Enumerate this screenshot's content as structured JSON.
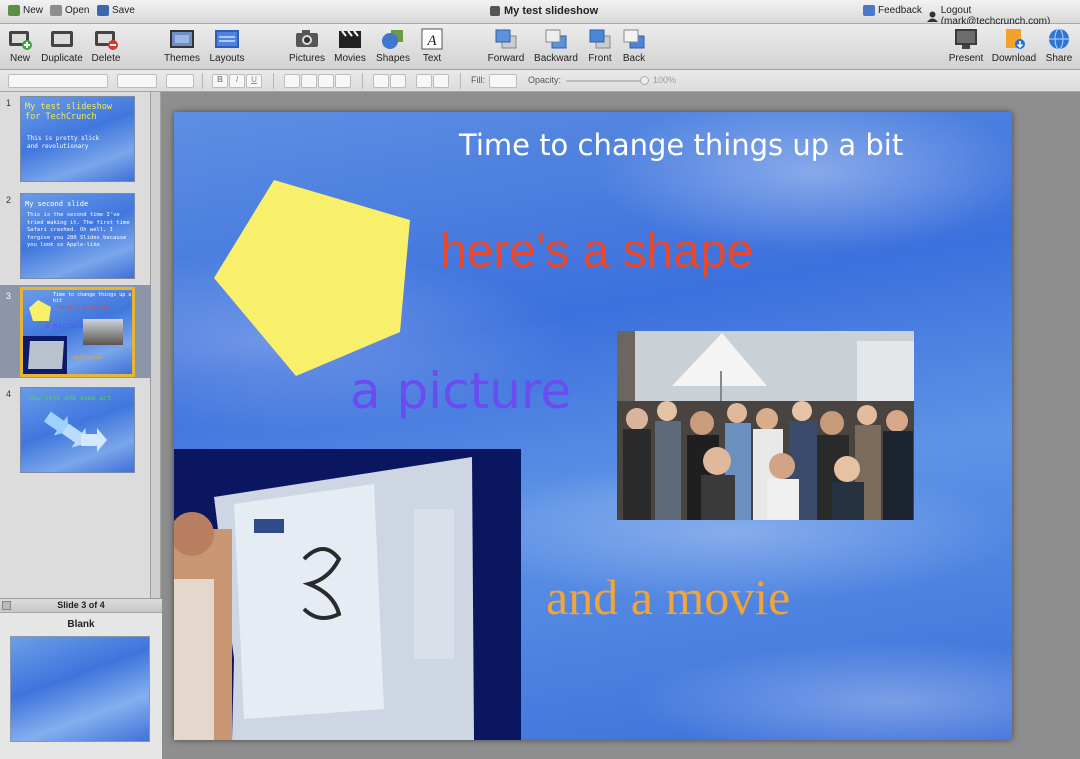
{
  "menubar": {
    "new_label": "New",
    "open_label": "Open",
    "save_label": "Save",
    "document_title": "My test slideshow",
    "feedback_label": "Feedback",
    "logout_label": "Logout (mark@techcrunch.com)"
  },
  "toolbar": {
    "new": "New",
    "duplicate": "Duplicate",
    "delete": "Delete",
    "themes": "Themes",
    "layouts": "Layouts",
    "pictures": "Pictures",
    "movies": "Movies",
    "shapes": "Shapes",
    "text": "Text",
    "forward": "Forward",
    "backward": "Backward",
    "front": "Front",
    "back": "Back",
    "present": "Present",
    "download": "Download",
    "share": "Share"
  },
  "formatbar": {
    "bold": "B",
    "italic": "I",
    "underline": "U",
    "fill_label": "Fill:",
    "opacity_label": "Opacity:",
    "opacity_value": "100%"
  },
  "slides": [
    {
      "number": "1",
      "title": "My test slideshow for TechCrunch",
      "body": "This is pretty slick and revolutionary"
    },
    {
      "number": "2",
      "title": "My second slide",
      "body": "This is the second time I've tried making it. The first time Safari crashed. Oh well, I forgive you 280 Slides because you look so Apple-like"
    },
    {
      "number": "3",
      "title": "Time to change things up a bit",
      "line1": "here's a shape",
      "line2": "a picture",
      "line3": "and a movie"
    },
    {
      "number": "4",
      "title": "Now lets add some art"
    }
  ],
  "selected_slide_index": 2,
  "layout_panel": {
    "header": "Slide 3 of 4",
    "layout_name": "Blank"
  },
  "current_slide": {
    "title": "Time to change things up a bit",
    "shape_text": "here's a shape",
    "picture_text": "a picture",
    "movie_text": "and a movie",
    "shape_icon": "pentagon-shape",
    "colors": {
      "title": "#ffffff",
      "shape_text": "#e6492e",
      "picture_text": "#6a4cf0",
      "movie_text": "#f0a43a",
      "pentagon": "#f8ef6a"
    }
  }
}
